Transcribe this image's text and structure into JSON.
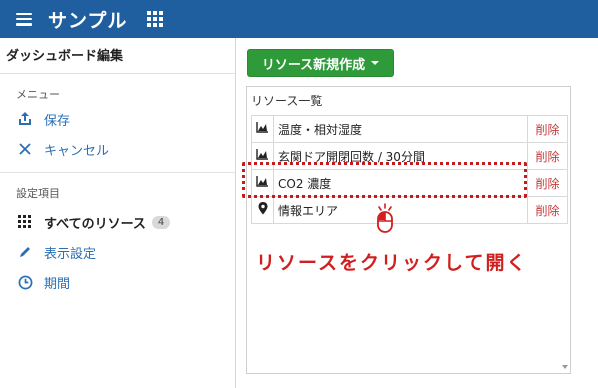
{
  "header": {
    "title": "サンプル",
    "menu_icon": "hamburger-icon",
    "apps_icon": "grid-icon",
    "background": "#1f5fa0"
  },
  "sidebar": {
    "title": "ダッシュボード編集",
    "menu_section": "メニュー",
    "menu_items": [
      {
        "label": "保存",
        "icon": "save-upload-icon"
      },
      {
        "label": "キャンセル",
        "icon": "close-icon"
      }
    ],
    "settings_section": "設定項目",
    "settings_items": [
      {
        "label": "すべてのリソース",
        "icon": "grid-icon",
        "badge": "4"
      },
      {
        "label": "表示設定",
        "icon": "pencil-icon"
      },
      {
        "label": "期間",
        "icon": "clock-icon"
      }
    ]
  },
  "main": {
    "create_button": "リソース新規作成",
    "panel_title": "リソース一覧",
    "delete_label": "削除",
    "resources": [
      {
        "name": "温度・相対湿度",
        "icon": "chart-icon"
      },
      {
        "name": "玄関ドア開閉回数 / 30分間",
        "icon": "chart-icon"
      },
      {
        "name": "CO2 濃度",
        "icon": "chart-icon"
      },
      {
        "name": "情報エリア",
        "icon": "pin-icon"
      }
    ],
    "hint": "リソースをクリックして開く",
    "accent_green": "#2e9a3a",
    "accent_red": "#c41c1c"
  }
}
